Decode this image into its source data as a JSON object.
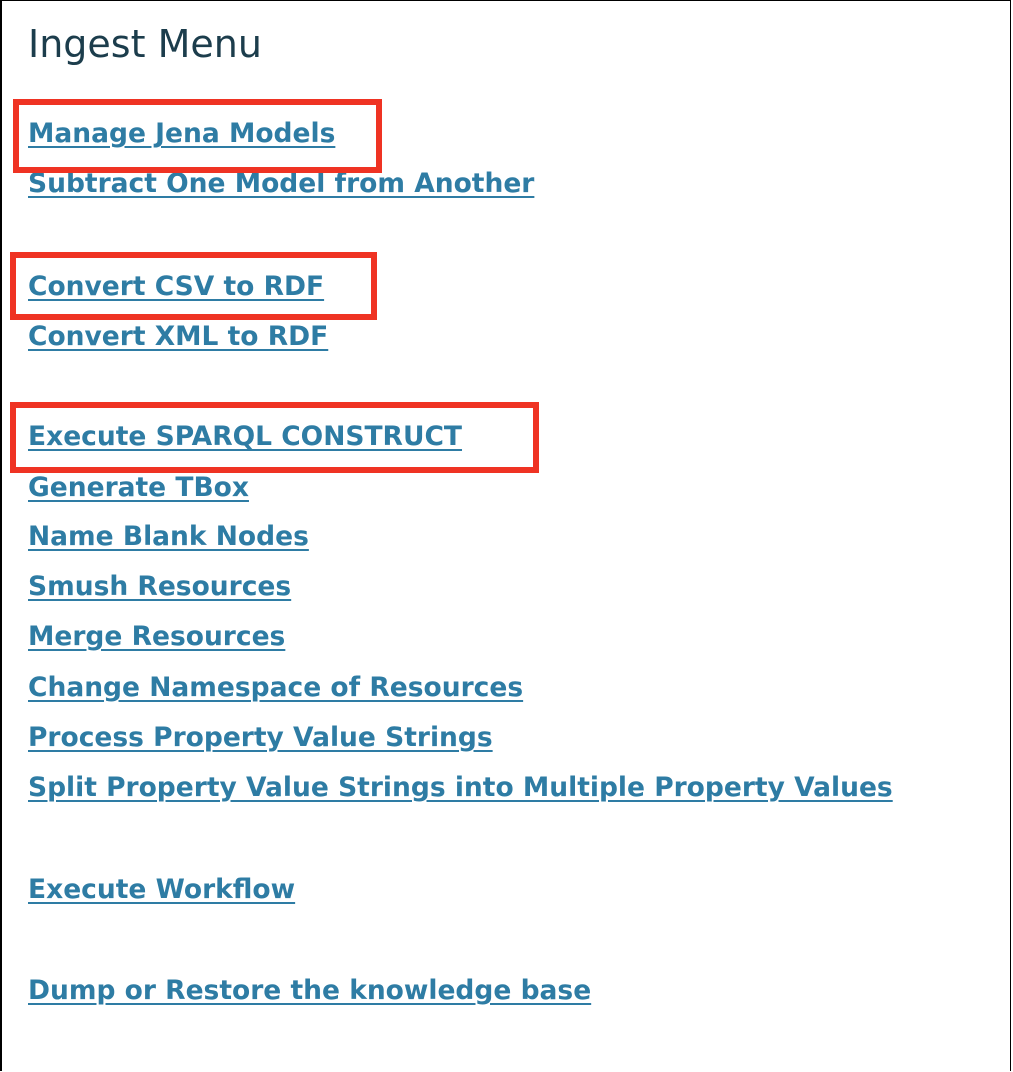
{
  "page": {
    "title": "Ingest Menu"
  },
  "menu": {
    "items": [
      {
        "label": "Manage Jena Models"
      },
      {
        "label": "Subtract One Model from Another"
      },
      {
        "label": "Convert CSV to RDF"
      },
      {
        "label": "Convert XML to RDF"
      },
      {
        "label": "Execute SPARQL CONSTRUCT"
      },
      {
        "label": "Generate TBox"
      },
      {
        "label": "Name Blank Nodes"
      },
      {
        "label": "Smush Resources"
      },
      {
        "label": "Merge Resources"
      },
      {
        "label": "Change Namespace of Resources"
      },
      {
        "label": "Process Property Value Strings"
      },
      {
        "label": "Split Property Value Strings into Multiple Property Values"
      },
      {
        "label": "Execute Workflow"
      },
      {
        "label": "Dump or Restore the knowledge base"
      }
    ]
  },
  "colors": {
    "link": "#2e7ca4",
    "title": "#1c3d4c",
    "highlight": "#ef3323",
    "border": "#000000",
    "background": "#ffffff"
  }
}
